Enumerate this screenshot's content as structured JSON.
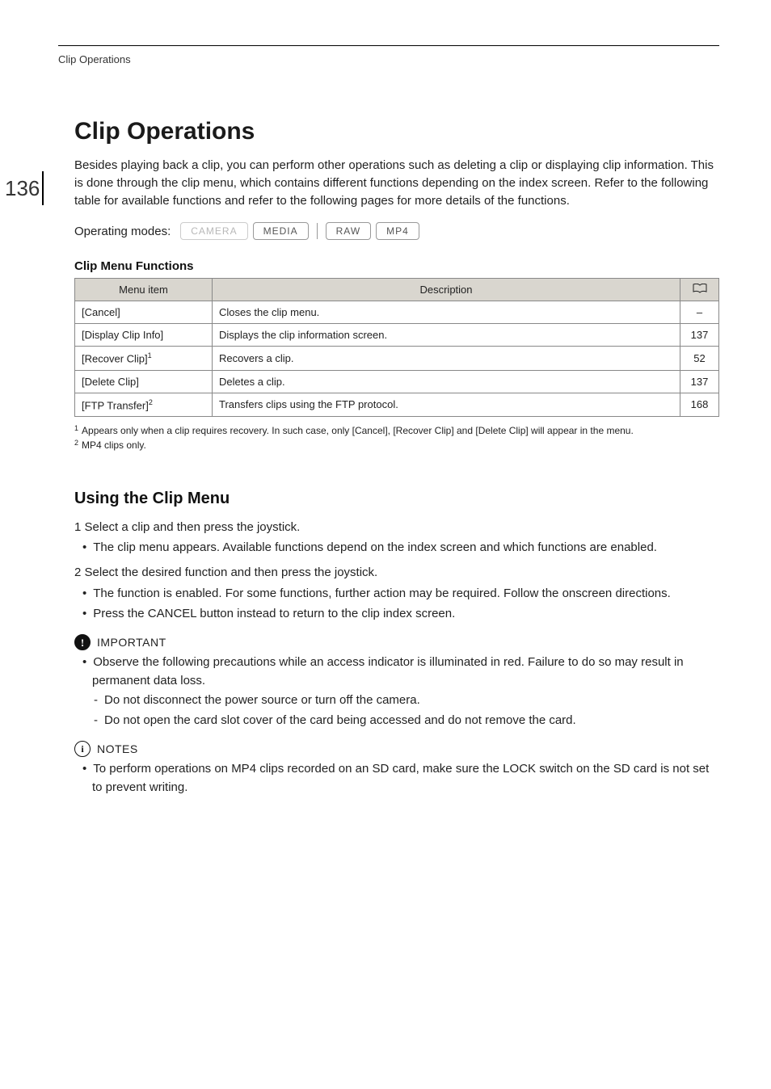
{
  "running_header": "Clip Operations",
  "page_number": "136",
  "title": "Clip Operations",
  "intro": "Besides playing back a clip, you can perform other operations such as deleting a clip or displaying clip information. This is done through the clip menu, which contains different functions depending on the index screen. Refer to the following table for available functions and refer to the following pages for more details of the functions.",
  "operating_modes": {
    "label": "Operating modes:",
    "modes": [
      {
        "text": "CAMERA",
        "dim": true
      },
      {
        "text": "MEDIA",
        "dim": false
      },
      {
        "text": "RAW",
        "dim": false
      },
      {
        "text": "MP4",
        "dim": false
      }
    ]
  },
  "table": {
    "caption": "Clip Menu Functions",
    "headers": {
      "menu": "Menu item",
      "desc": "Description",
      "page_icon": "book-icon"
    },
    "rows": [
      {
        "menu": "[Cancel]",
        "sup": "",
        "desc": "Closes the clip menu.",
        "page": "–"
      },
      {
        "menu": "[Display Clip Info]",
        "sup": "",
        "desc": "Displays the clip information screen.",
        "page": "137"
      },
      {
        "menu": "[Recover Clip]",
        "sup": "1",
        "desc": "Recovers a clip.",
        "page": "52"
      },
      {
        "menu": "[Delete Clip]",
        "sup": "",
        "desc": "Deletes a clip.",
        "page": "137"
      },
      {
        "menu": "[FTP Transfer]",
        "sup": "2",
        "desc": "Transfers clips using the FTP protocol.",
        "page": "168"
      }
    ]
  },
  "footnotes": [
    {
      "num": "1",
      "text": "Appears only when a clip requires recovery. In such case, only [Cancel], [Recover Clip] and [Delete Clip] will appear in the menu."
    },
    {
      "num": "2",
      "text": "MP4 clips only."
    }
  ],
  "using": {
    "heading": "Using the Clip Menu",
    "step1": "1 Select a clip and then press the joystick.",
    "step1_bullet": "The clip menu appears. Available functions depend on the index screen and which functions are enabled.",
    "step2": "2 Select the desired function and then press the joystick.",
    "step2_bullets": [
      "The function is enabled. For some functions, further action may be required. Follow the onscreen directions.",
      "Press the CANCEL button instead to return to the clip index screen."
    ]
  },
  "important": {
    "label": "IMPORTANT",
    "bullet": "Observe the following precautions while an access indicator is illuminated in red. Failure to do so may result in permanent data loss.",
    "subs": [
      "Do not disconnect the power source or turn off the camera.",
      "Do not open the card slot cover of the card being accessed and do not remove the card."
    ]
  },
  "notes": {
    "label": "NOTES",
    "bullet": "To perform operations on MP4 clips recorded on an SD card, make sure the LOCK switch on the SD card is not set to prevent writing."
  }
}
